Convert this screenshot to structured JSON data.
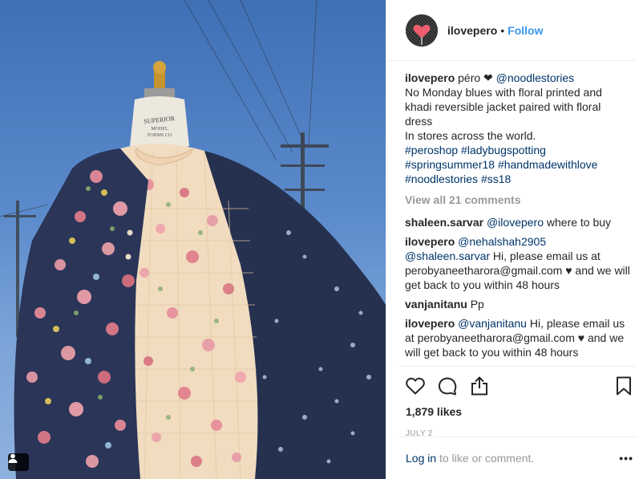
{
  "header": {
    "username": "ilovepero",
    "separator": "•",
    "follow_label": "Follow"
  },
  "caption": {
    "username": "ilovepero",
    "text_lead": "péro ❤ ",
    "mention": "@noodlestories",
    "line1": "No Monday blues with floral printed and khadi reversible jacket paired with floral dress",
    "line2": "In stores across the world.",
    "hashtags": "#peroshop #ladybugspotting #springsummer18 #handmadewithlove #noodlestories #ss18"
  },
  "view_all": "View all 21 comments",
  "comments": [
    {
      "user": "shaleen.sarvar",
      "mention": "@ilovepero",
      "text": " where to buy"
    },
    {
      "user": "ilovepero",
      "mention": "@nehalshah2905",
      "mention2": "@shaleen.sarvar",
      "text": " Hi, please email us at perobyaneetharora@gmail.com ♥ and we will get back to you within 48 hours"
    },
    {
      "user": "vanjanitanu",
      "mention": "",
      "text": "Pp"
    },
    {
      "user": "ilovepero",
      "mention": "@vanjanitanu",
      "text": " Hi, please email us at perobyaneetharora@gmail.com ♥ and we will get back to you within 48 hours"
    }
  ],
  "actions": {
    "likes": "1,879 likes",
    "date": "JULY 2"
  },
  "login": {
    "link": "Log in",
    "rest": " to like or comment.",
    "more": "•••"
  },
  "icons": {
    "like": "heart-icon",
    "comment": "comment-icon",
    "share": "share-icon",
    "save": "bookmark-icon",
    "tag": "user-tag-icon"
  },
  "mannequin_label": "SUPERIOR MODEL FORMS CO",
  "colors": {
    "link_blue": "#3897f0",
    "mention_blue": "#003569",
    "muted": "#999999",
    "text": "#262626",
    "sky": "#5c8bcc",
    "jacket": "#2a3558",
    "dress": "#f1dcc0"
  }
}
